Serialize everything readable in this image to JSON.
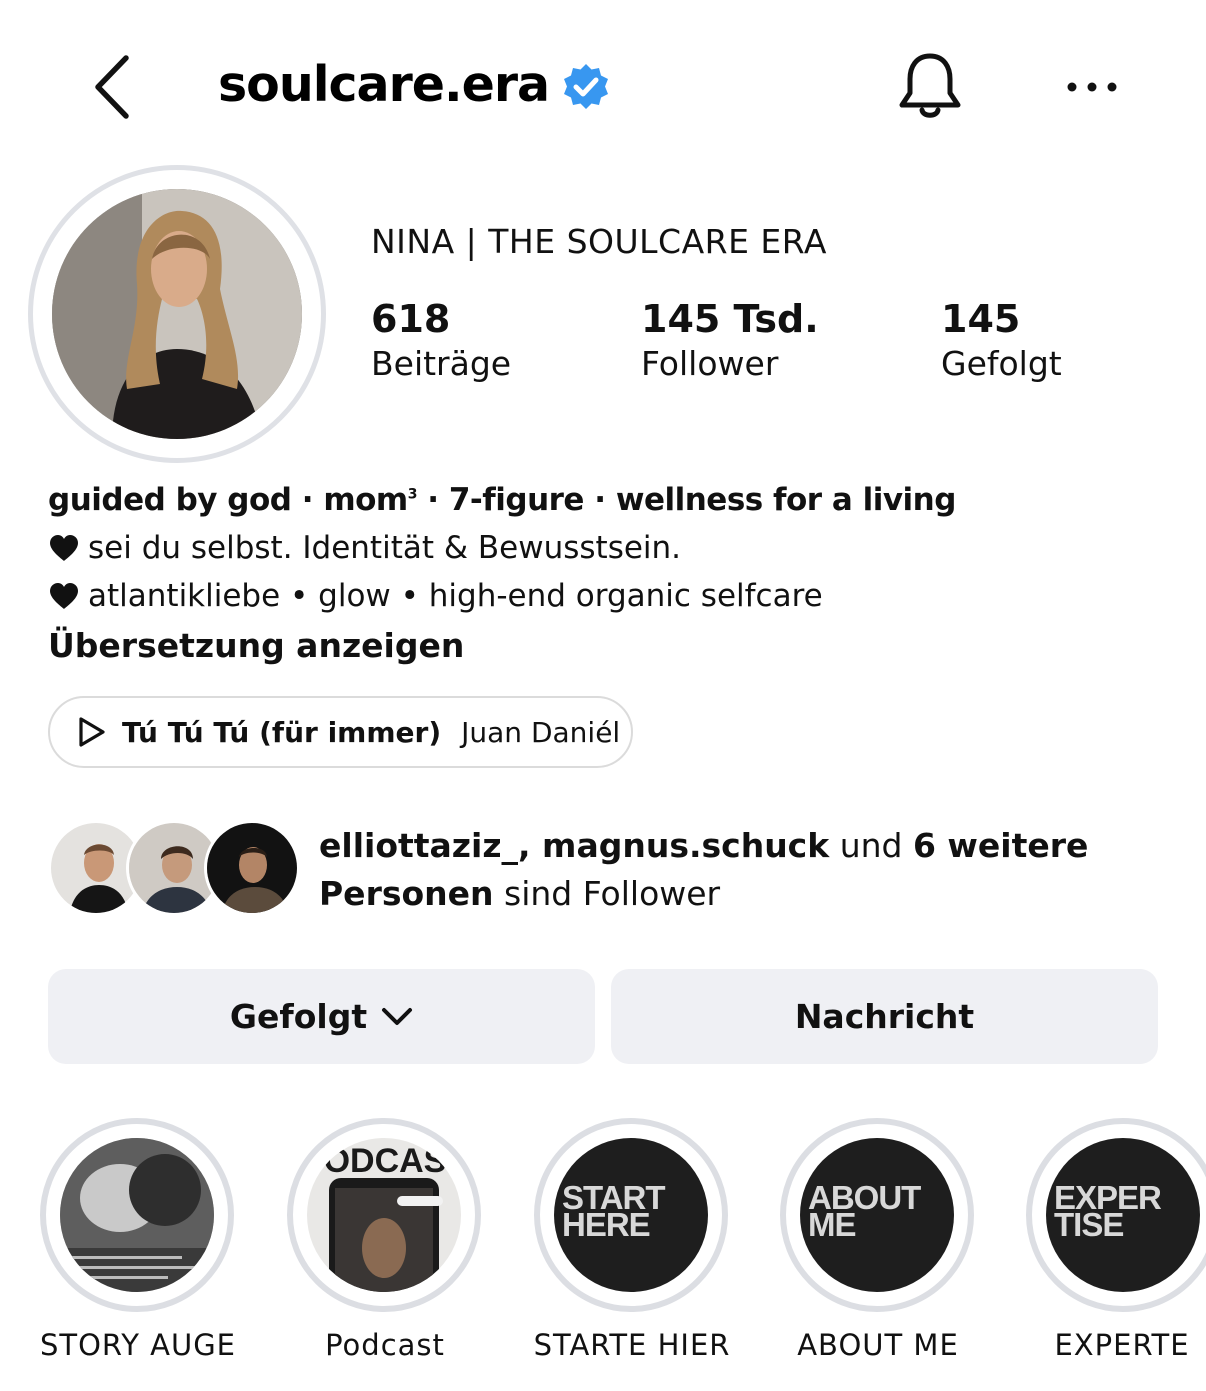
{
  "header": {
    "username": "soulcare.era",
    "verified": true,
    "icons": [
      "back-icon",
      "verified-badge-icon",
      "bell-icon",
      "more-icon"
    ]
  },
  "profile": {
    "full_name": "NINA | THE SOULCARE ERA",
    "stats": [
      {
        "value": "618",
        "label": "Beiträge"
      },
      {
        "value": "145 Tsd.",
        "label": "Follower"
      },
      {
        "value": "145",
        "label": "Gefolgt"
      }
    ]
  },
  "bio": {
    "line1_part1": "guided by god · mom",
    "line1_sup": "3",
    "line1_part2": " · 7-figure · wellness for a living",
    "line2": "sei du selbst. Identität & Bewusstsein.",
    "line3": "atlantikliebe • glow • high-end organic selfcare",
    "translate": "Übersetzung anzeigen"
  },
  "music": {
    "title": "Tú Tú Tú (für immer)",
    "artist": "Juan Daniél"
  },
  "mutual": {
    "names": "elliottaziz_, magnus.schuck",
    "connector": " und ",
    "more": "6 weitere",
    "line2_bold": "Personen",
    "line2_rest": " sind Follower"
  },
  "buttons": {
    "following": "Gefolgt",
    "message": "Nachricht"
  },
  "highlights": [
    {
      "label": "STORY AUGE",
      "cover_text": ""
    },
    {
      "label": "Podcast",
      "cover_text": "PODCAST"
    },
    {
      "label": "STARTE HIER",
      "cover_text": "START HERE"
    },
    {
      "label": "ABOUT ME",
      "cover_text": "ABOUT ME"
    },
    {
      "label": "EXPERTE",
      "cover_text": "EXPER TISE"
    }
  ],
  "colors": {
    "verified_blue": "#3897f0",
    "button_bg": "#eff0f4",
    "ring_gray": "#dcdee3"
  }
}
